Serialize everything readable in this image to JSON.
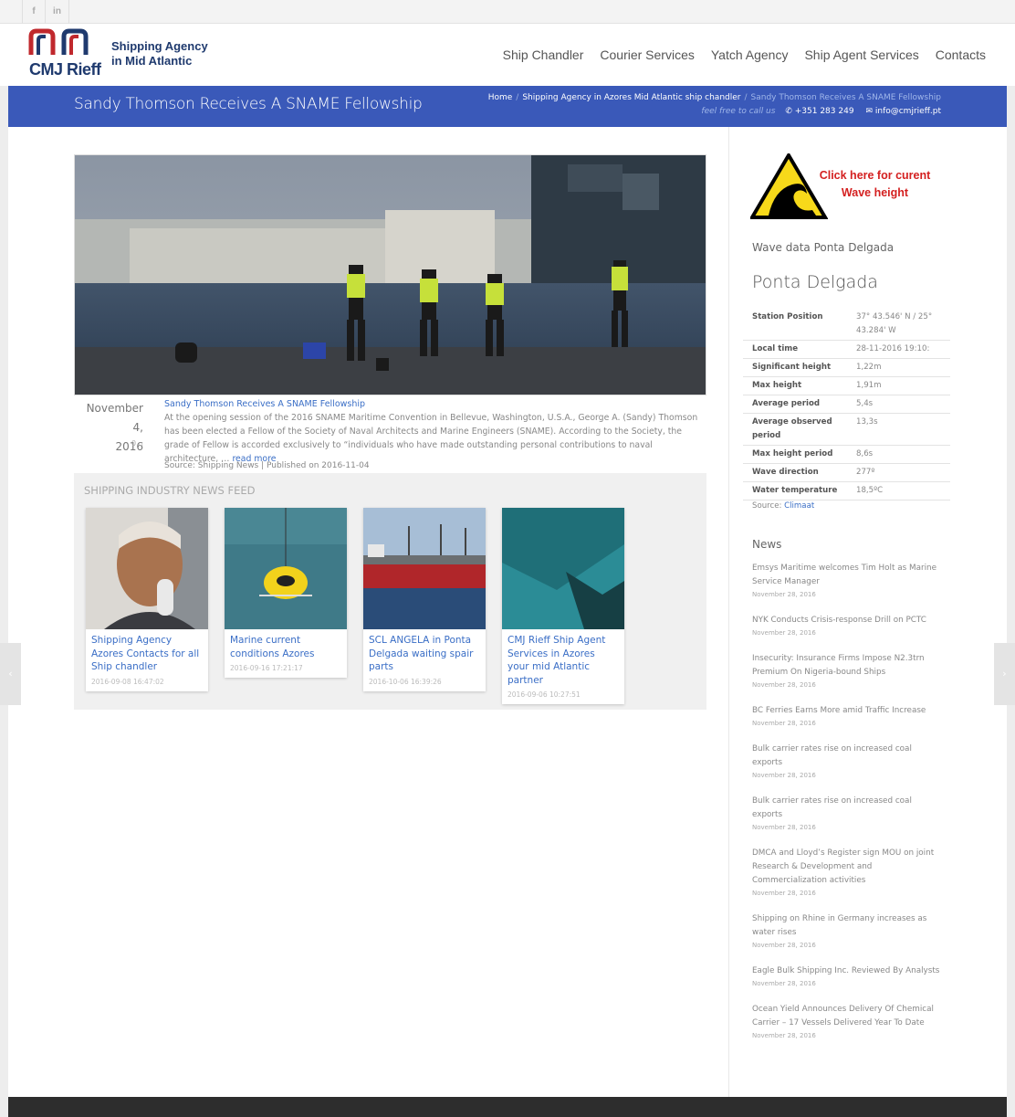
{
  "social": {
    "facebook": "f",
    "linkedin": "in"
  },
  "header": {
    "logo_line1": "Shipping Agency",
    "logo_line2": "in Mid Atlantic",
    "logo_brand": "CMJ Rieff",
    "nav": [
      "Ship Chandler",
      "Courier Services",
      "Yatch Agency",
      "Ship Agent Services",
      "Contacts"
    ]
  },
  "titlebar": {
    "title": "Sandy Thomson Receives A SNAME Fellowship",
    "breadcrumb": [
      "Home",
      "Shipping Agency in Azores Mid Atlantic ship chandler",
      "Sandy Thomson Receives A SNAME Fellowship"
    ],
    "sep": "/",
    "free_call": "feel free to call us",
    "phone": "+351 283 249",
    "email": "info@cmjrieff.pt"
  },
  "post": {
    "date_line1": "November 4,",
    "date_line2": "2016",
    "comments": "0",
    "title": "Sandy Thomson Receives A SNAME Fellowship",
    "excerpt": "At the opening session of the 2016 SNAME Maritime Convention in Bellevue, Washington, U.S.A., George A. (Sandy) Thomson has been elected a Fellow of the Society of Naval Architects and Marine Engineers (SNAME). According to the Society, the grade of Fellow is accorded exclusively to “individuals who have made outstanding personal contributions to naval architecture, …",
    "read_more": "read more",
    "source": "Source: Shipping News | Published on 2016-11-04"
  },
  "feed": {
    "title": "SHIPPING INDUSTRY NEWS FEED",
    "cards": [
      {
        "title": "Shipping Agency Azores Contacts for all Ship chandler",
        "date": "2016-09-08 16:47:02"
      },
      {
        "title": "Marine current conditions Azores",
        "date": "2016-09-16 17:21:17"
      },
      {
        "title": "SCL ANGELA in Ponta Delgada waiting spair parts",
        "date": "2016-10-06 16:39:26"
      },
      {
        "title": "CMJ Rieff Ship Agent Services in Azores your mid Atlantic partner",
        "date": "2016-09-06 10:27:51"
      }
    ]
  },
  "sidebar": {
    "wave_cta_line1": "Click here for curent",
    "wave_cta_line2": "Wave height",
    "wave_heading": "Wave data Ponta Delgada",
    "station": "Ponta Delgada",
    "rows": [
      {
        "k": "Station Position",
        "v": "37° 43.546' N / 25° 43.284' W"
      },
      {
        "k": "Local time",
        "v": "28-11-2016 19:10:"
      },
      {
        "k": "Significant height",
        "v": "1,22m"
      },
      {
        "k": "Max height",
        "v": "1,91m"
      },
      {
        "k": "Average period",
        "v": "5,4s"
      },
      {
        "k": "Average observed period",
        "v": "13,3s"
      },
      {
        "k": "Max height period",
        "v": "8,6s"
      },
      {
        "k": "Wave direction",
        "v": "277º"
      },
      {
        "k": "Water temperature",
        "v": "18,5ºC"
      }
    ],
    "source_label": "Source:",
    "source_link": "Climaat",
    "news_title": "News",
    "news": [
      {
        "t": "Emsys Maritime welcomes Tim Holt as Marine Service Manager",
        "d": "November 28, 2016"
      },
      {
        "t": "NYK Conducts Crisis-response Drill on PCTC",
        "d": "November 28, 2016"
      },
      {
        "t": "Insecurity: Insurance Firms Impose N2.3trn Premium On Nigeria-bound Ships",
        "d": "November 28, 2016"
      },
      {
        "t": "BC Ferries Earns More amid Traffic Increase",
        "d": "November 28, 2016"
      },
      {
        "t": "Bulk carrier rates rise on increased coal exports",
        "d": "November 28, 2016"
      },
      {
        "t": "Bulk carrier rates rise on increased coal exports",
        "d": "November 28, 2016"
      },
      {
        "t": "DMCA and Lloyd’s Register sign MOU on joint Research & Development and Commercialization activities",
        "d": "November 28, 2016"
      },
      {
        "t": "Shipping on Rhine in Germany increases as water rises",
        "d": "November 28, 2016"
      },
      {
        "t": "Eagle Bulk Shipping Inc. Reviewed By Analysts",
        "d": "November 28, 2016"
      },
      {
        "t": "Ocean Yield Announces Delivery Of Chemical Carrier – 17 Vessels Delivered Year To Date",
        "d": "November 28, 2016"
      }
    ]
  },
  "arrows": {
    "left": "‹",
    "right": "›"
  },
  "colors": {
    "brand_blue": "#3a59b9",
    "link": "#3a6ec6",
    "logo_red": "#c0282d",
    "logo_navy": "#1f3a6e",
    "alert_red": "#d42020"
  }
}
